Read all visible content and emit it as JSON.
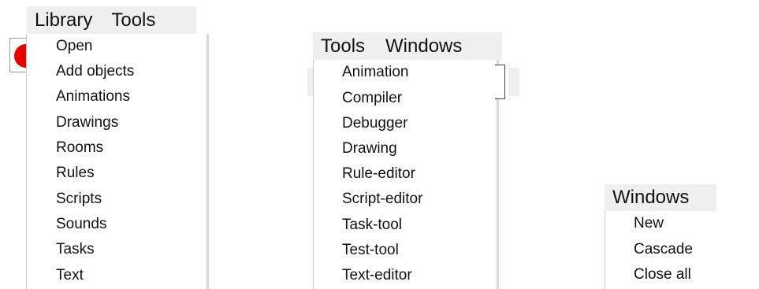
{
  "menubars": {
    "library_bar": [
      "Library",
      "Tools"
    ],
    "tools_bar": [
      "Tools",
      "Windows"
    ],
    "windows_bar": [
      "Windows"
    ]
  },
  "menus": {
    "library": [
      "Open",
      "Add objects",
      "Animations",
      "Drawings",
      "Rooms",
      "Rules",
      "Scripts",
      "Sounds",
      "Tasks",
      "Text"
    ],
    "tools": [
      "Animation",
      "Compiler",
      "Debugger",
      "Drawing",
      "Rule-editor",
      "Script-editor",
      "Task-tool",
      "Test-tool",
      "Text-editor"
    ],
    "windows": [
      "New",
      "Cascade",
      "Close all"
    ]
  },
  "colors": {
    "menubar_bg": "#efefef",
    "accent_red": "#e60000"
  }
}
